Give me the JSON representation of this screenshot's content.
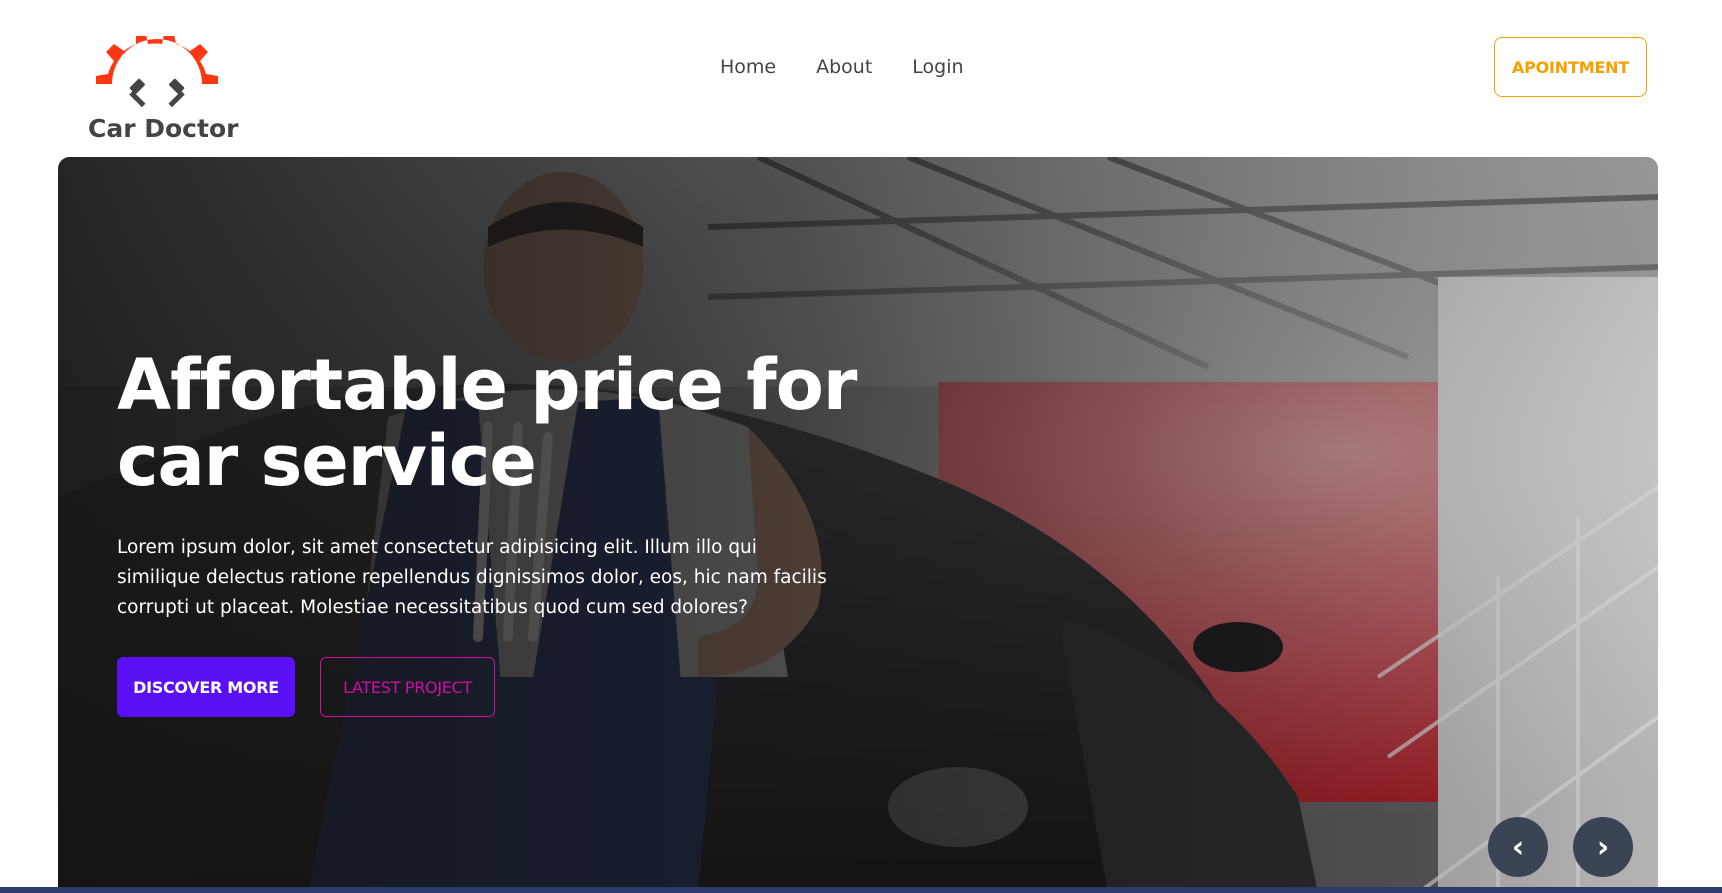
{
  "brand": {
    "name": "Car Doctor",
    "accent_color": "#FF3811",
    "icon": "gear-piston-logo"
  },
  "nav": {
    "links": [
      "Home",
      "About",
      "Login"
    ],
    "appointment_label": "APOINTMENT",
    "appointment_color": "#F5A100"
  },
  "hero": {
    "title": "Affortable price for car service",
    "description": "Lorem ipsum dolor, sit amet consectetur adipisicing elit. Illum illo qui similique delectus ratione repellendus dignissimos dolor, eos, hic nam facilis corrupti ut placeat. Molestiae necessitatibus quod cum sed dolores?",
    "discover_label": "DISCOVER MORE",
    "discover_color": "#5B0FF5",
    "latest_label": "LATEST PROJECT",
    "latest_color": "#D10FA3",
    "prev_label": "‹",
    "next_label": "›"
  }
}
